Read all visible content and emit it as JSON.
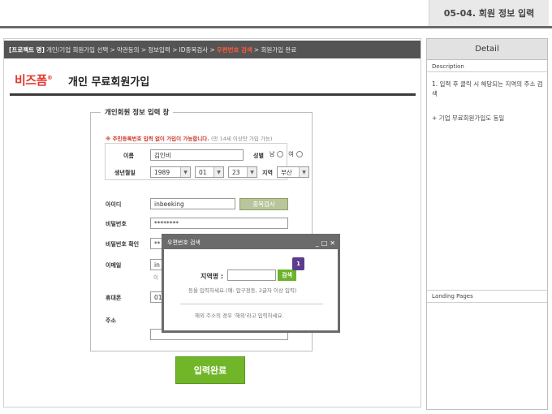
{
  "page_code": "05-04. 회원 정보 입력",
  "breadcrumb": [
    {
      "label": "[프로젝트 명]",
      "kind": "first"
    },
    {
      "label": "개인/기업 회원가입 선택 >",
      "kind": "normal"
    },
    {
      "label": "약관동의 >",
      "kind": "normal"
    },
    {
      "label": "정보입력 >",
      "kind": "normal"
    },
    {
      "label": "ID중복검사 >",
      "kind": "normal"
    },
    {
      "label": "우편번호 검색",
      "kind": "active"
    },
    {
      "label": "> 회원가입 완료",
      "kind": "normal"
    }
  ],
  "logo": "비즈폼",
  "logo_mark": "®",
  "page_title": "개인 무료회원가입",
  "form": {
    "legend": "개인회원 정보 입력 창",
    "notice": "※ 주민등록번호 입력 없이 가입이 가능합니다.",
    "notice_sub": "(만 14세 이상만 가입 가능)",
    "name_label": "이름",
    "name_value": "김인비",
    "gender_label": "성별",
    "gender_male": "남",
    "gender_female": "여",
    "birth_label": "생년월일",
    "birth_year": "1989",
    "birth_month": "01",
    "birth_day": "23",
    "region_label": "지역",
    "region_value": "부산",
    "id_label": "아이디",
    "id_value": "inbeeking",
    "dup_button": "중복검사",
    "pw_label": "비밀번호",
    "pw_value": "********",
    "pw_confirm_label": "비밀번호 확인",
    "pw_confirm_value": "**",
    "email_label": "이메일",
    "email_value": "in",
    "email_note": "이",
    "phone_label": "휴대폰",
    "phone_value": "01",
    "address_label": "주소",
    "submit_button": "입력완료"
  },
  "popup": {
    "title": "우편번호 검색",
    "ctrl_min": "_",
    "ctrl_max": "□",
    "ctrl_close": "✕",
    "region_label": "지역명 :",
    "search_button": "검색",
    "badge": "1",
    "hint": "동을 입력하세요.(예: 압구정동, 2글자 이상 입력)",
    "overseas": "해외 주소의 경우 '해외'라고 입력하세요."
  },
  "right_panel": {
    "header": "Detail",
    "description_label": "Description",
    "item1": "1.  입력 후 클릭 시 해당되는 지역의 주소 검색",
    "item2": "+ 기업 무료회원가입도 동일",
    "landing_label": "Landing Pages"
  },
  "colors": {
    "breadcrumb_bg": "#545454",
    "active_crumb": "#ff5a3c",
    "logo": "#e03a2f",
    "submit": "#71b629",
    "badge": "#5c3c8c"
  }
}
